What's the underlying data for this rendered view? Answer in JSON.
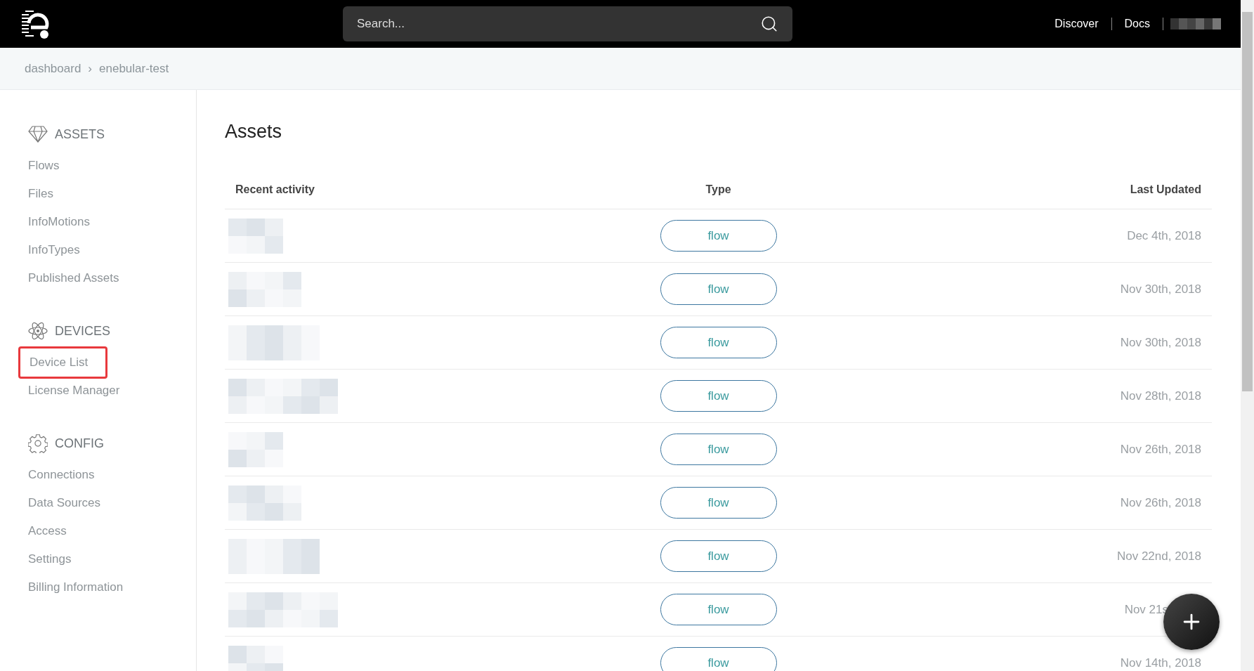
{
  "topbar": {
    "search": {
      "placeholder": "Search..."
    },
    "links": [
      "Discover",
      "Docs"
    ]
  },
  "breadcrumb": [
    "dashboard",
    "›",
    "enebular-test"
  ],
  "sidebar": {
    "sections": [
      {
        "kind": "assets",
        "title": "ASSETS",
        "items": [
          {
            "label": "Flows",
            "highlighted": false
          },
          {
            "label": "Files",
            "highlighted": false
          },
          {
            "label": "InfoMotions",
            "highlighted": false
          },
          {
            "label": "InfoTypes",
            "highlighted": false
          },
          {
            "label": "Published Assets",
            "highlighted": false
          }
        ]
      },
      {
        "kind": "devices",
        "title": "DEVICES",
        "items": [
          {
            "label": "Device List",
            "highlighted": true
          },
          {
            "label": "License Manager",
            "highlighted": false
          }
        ]
      },
      {
        "kind": "config",
        "title": "CONFIG",
        "items": [
          {
            "label": "Connections",
            "highlighted": false
          },
          {
            "label": "Data Sources",
            "highlighted": false
          },
          {
            "label": "Access",
            "highlighted": false
          },
          {
            "label": "Settings",
            "highlighted": false
          },
          {
            "label": "Billing Information",
            "highlighted": false
          }
        ]
      }
    ]
  },
  "main": {
    "title": "Assets",
    "table": {
      "columns": [
        "Recent activity",
        "Type",
        "Last Updated"
      ],
      "rows": [
        {
          "type": "flow",
          "updated": "Dec 4th, 2018",
          "covered": false
        },
        {
          "type": "flow",
          "updated": "Nov 30th, 2018",
          "covered": false
        },
        {
          "type": "flow",
          "updated": "Nov 30th, 2018",
          "covered": false
        },
        {
          "type": "flow",
          "updated": "Nov 28th, 2018",
          "covered": false
        },
        {
          "type": "flow",
          "updated": "Nov 26th, 2018",
          "covered": false
        },
        {
          "type": "flow",
          "updated": "Nov 26th, 2018",
          "covered": false
        },
        {
          "type": "flow",
          "updated": "Nov 22nd, 2018",
          "covered": false
        },
        {
          "type": "flow",
          "updated": "Nov 21s",
          "covered": true
        },
        {
          "type": "flow",
          "updated": "Nov 14th, 2018",
          "covered": false
        }
      ]
    }
  }
}
